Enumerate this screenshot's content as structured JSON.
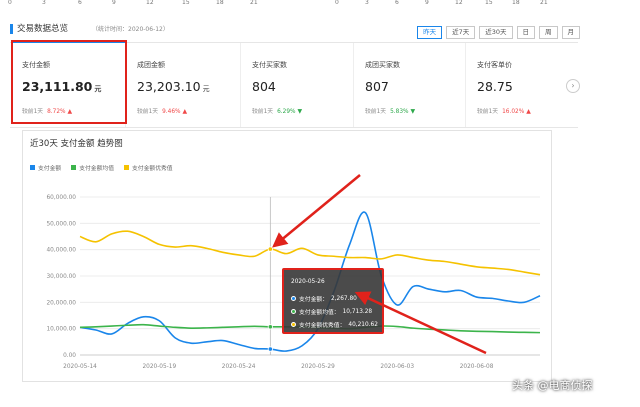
{
  "top_axis_ticks": {
    "left": [
      "0",
      "3",
      "6",
      "9",
      "12",
      "15",
      "18",
      "21"
    ],
    "right": [
      "0",
      "3",
      "6",
      "9",
      "12",
      "15",
      "18",
      "21"
    ]
  },
  "section": {
    "title": "交易数据总览",
    "subtitle": "（统计时间：2020-06-12）"
  },
  "range_tabs": [
    {
      "label": "昨天",
      "active": true
    },
    {
      "label": "近7天",
      "active": false
    },
    {
      "label": "近30天",
      "active": false
    },
    {
      "label": "日",
      "active": false
    },
    {
      "label": "周",
      "active": false
    },
    {
      "label": "月",
      "active": false
    }
  ],
  "cards": [
    {
      "label": "支付金额",
      "value": "23,111.80",
      "unit": "元",
      "compare": "较前1天",
      "pct": "8.72%",
      "trend": "up"
    },
    {
      "label": "成团金额",
      "value": "23,203.10",
      "unit": "元",
      "compare": "较前1天",
      "pct": "9.46%",
      "trend": "up"
    },
    {
      "label": "支付买家数",
      "value": "804",
      "unit": "",
      "compare": "较前1天",
      "pct": "6.29%",
      "trend": "down"
    },
    {
      "label": "成团买家数",
      "value": "807",
      "unit": "",
      "compare": "较前1天",
      "pct": "5.83%",
      "trend": "down"
    },
    {
      "label": "支付客单价",
      "value": "28.75",
      "unit": "",
      "compare": "较前1天",
      "pct": "16.02%",
      "trend": "up"
    }
  ],
  "icons": {
    "next": "chevron-right-icon",
    "up": "arrow-up-icon",
    "down": "arrow-down-icon"
  },
  "colors": {
    "accent": "#1a86ea",
    "up": "#f04848",
    "down": "#2ca84a",
    "series_blue": "#1a86ea",
    "series_green": "#3cb44b",
    "series_yellow": "#f5c200",
    "highlight": "#e0221b"
  },
  "chart_title": "近30天 支付金额 趋势图",
  "chart_data": {
    "type": "line",
    "x": [
      "2020-05-14",
      "2020-05-15",
      "2020-05-16",
      "2020-05-17",
      "2020-05-18",
      "2020-05-19",
      "2020-05-20",
      "2020-05-21",
      "2020-05-22",
      "2020-05-23",
      "2020-05-24",
      "2020-05-25",
      "2020-05-26",
      "2020-05-27",
      "2020-05-28",
      "2020-05-29",
      "2020-05-30",
      "2020-05-31",
      "2020-06-01",
      "2020-06-02",
      "2020-06-03",
      "2020-06-04",
      "2020-06-05",
      "2020-06-06",
      "2020-06-07",
      "2020-06-08",
      "2020-06-09",
      "2020-06-10",
      "2020-06-11",
      "2020-06-12"
    ],
    "x_tick_labels": [
      "2020-05-14",
      "2020-05-19",
      "2020-05-24",
      "2020-05-29",
      "2020-06-03",
      "2020-06-08"
    ],
    "ylim": [
      0,
      60000
    ],
    "y_tick_labels": [
      "0.00",
      "10,000.00",
      "20,000.00",
      "30,000.00",
      "40,000.00",
      "50,000.00",
      "60,000.00"
    ],
    "grid": true,
    "legend_position": "top-left",
    "series": [
      {
        "name": "支付金额",
        "color": "#1a86ea",
        "values": [
          10500,
          9500,
          8000,
          12000,
          14500,
          13000,
          6500,
          4500,
          5000,
          5500,
          4000,
          2500,
          2267.8,
          1500,
          3500,
          10000,
          24000,
          42000,
          54000,
          30000,
          19000,
          26000,
          25000,
          24000,
          24500,
          22000,
          21500,
          20500,
          20000,
          22500
        ]
      },
      {
        "name": "支付金额均值",
        "color": "#3cb44b",
        "values": [
          10500,
          10700,
          11000,
          11300,
          11500,
          11000,
          10500,
          10200,
          10300,
          10500,
          10700,
          10900,
          10713.28,
          10700,
          10600,
          10400,
          10200,
          10000,
          10500,
          11000,
          10800,
          10200,
          9800,
          9500,
          9200,
          9000,
          8900,
          8700,
          8600,
          8500
        ]
      },
      {
        "name": "支付金额优秀值",
        "color": "#f5c200",
        "values": [
          45000,
          43000,
          46000,
          47000,
          45000,
          42000,
          41000,
          41500,
          40500,
          39000,
          38000,
          37500,
          40210.62,
          38500,
          40500,
          38000,
          37500,
          37000,
          37000,
          36500,
          38000,
          37000,
          36000,
          35500,
          34500,
          33500,
          33000,
          32500,
          31500,
          30500
        ]
      }
    ]
  },
  "tooltip": {
    "date": "2020-05-26",
    "rows": [
      {
        "label": "支付金额：",
        "value": "2,267.80",
        "color": "#1a86ea"
      },
      {
        "label": "支付金额均值：",
        "value": "10,713.28",
        "color": "#3cb44b"
      },
      {
        "label": "支付金额优秀值：",
        "value": "40,210.62",
        "color": "#f5c200"
      }
    ]
  },
  "watermark": "头条 @电商侦探"
}
